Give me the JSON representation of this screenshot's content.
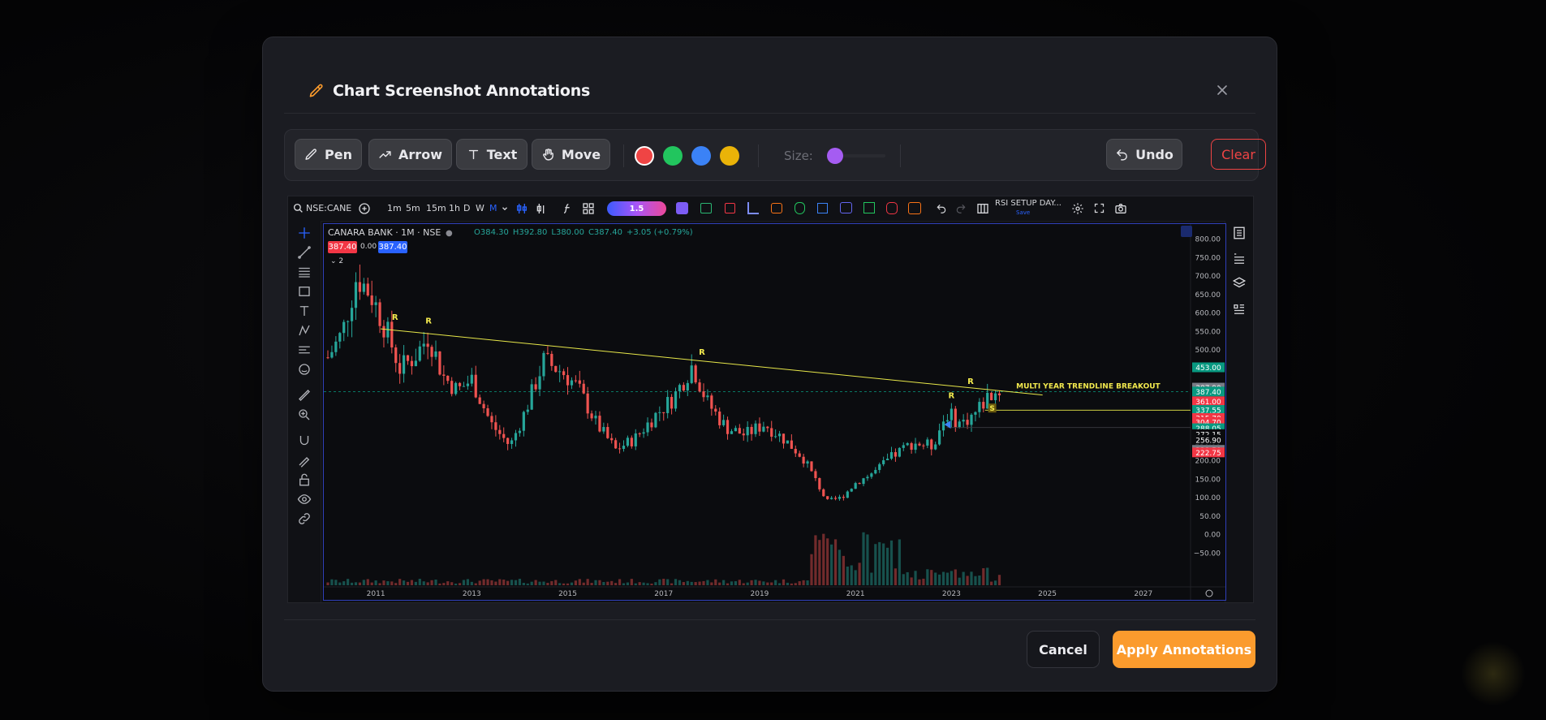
{
  "modal": {
    "title": "Chart Screenshot Annotations",
    "close_icon": "close-icon",
    "accent_color": "#fb9b2d"
  },
  "toolbar": {
    "tools": [
      {
        "label": "Pen",
        "icon": "pen-icon"
      },
      {
        "label": "Arrow",
        "icon": "arrow-icon"
      },
      {
        "label": "Text",
        "icon": "text-icon"
      },
      {
        "label": "Move",
        "icon": "hand-icon"
      }
    ],
    "colors": [
      "#ef4444",
      "#22c55e",
      "#3b82f6",
      "#eab308"
    ],
    "selected_color": "#ef4444",
    "size_label": "Size:",
    "size_color": "#a55cf2",
    "undo_label": "Undo",
    "clear_label": "Clear"
  },
  "tv": {
    "symbol": "NSE:CANE",
    "intervals": [
      "1m",
      "5m",
      "15m",
      "1h",
      "D",
      "W",
      "M"
    ],
    "active_interval": "M",
    "multiplier": "1.5",
    "layout_name": "RSI SETUP DAY...",
    "layout_save": "Save",
    "legend_title": "CANARA BANK · 1M · NSE",
    "ohlc": {
      "o": "O384.30",
      "h": "H392.80",
      "l": "L380.00",
      "c": "C387.40",
      "chg": "+3.05 (+0.79%)"
    },
    "price_box_sell": "387.40",
    "price_box_spread": "0.00",
    "price_box_buy": "387.40",
    "indicator_count": "2"
  },
  "chart_data": {
    "type": "candlestick",
    "symbol": "CANARA BANK",
    "interval": "1M",
    "x_ticks": [
      "2011",
      "2013",
      "2015",
      "2017",
      "2019",
      "2021",
      "2023",
      "2025",
      "2027"
    ],
    "y_ticks": [
      "800.00",
      "750.00",
      "700.00",
      "650.00",
      "600.00",
      "550.00",
      "500.00",
      "450.00",
      "400.00",
      "350.00",
      "300.00",
      "250.00",
      "200.00",
      "150.00",
      "100.00",
      "50.00",
      "0.00",
      "−50.00"
    ],
    "ylim": [
      -60,
      810
    ],
    "price_labels": [
      {
        "value": 453.0,
        "text": "453.00",
        "bg": "#089981"
      },
      {
        "value": 397.9,
        "text": "387.90",
        "bg": "#787b86"
      },
      {
        "value": 387.4,
        "text": "387.40",
        "bg": "#089981"
      },
      {
        "value": 361.0,
        "text": "361.00",
        "bg": "#f23645"
      },
      {
        "value": 337.55,
        "text": "337.55",
        "bg": "#089981"
      },
      {
        "value": 315.7,
        "text": "315.70",
        "bg": "#f23645"
      },
      {
        "value": 304.7,
        "text": "304.70",
        "bg": "#f23645"
      },
      {
        "value": 288.05,
        "text": "288.05",
        "bg": "#089981"
      },
      {
        "value": 272.15,
        "text": "272.15",
        "bg": "#0b0c0f"
      },
      {
        "value": 256.9,
        "text": "256.90",
        "bg": "#0b0c0f"
      },
      {
        "value": 229.5,
        "text": "229.50",
        "bg": "#787b86"
      },
      {
        "value": 222.75,
        "text": "222.75",
        "bg": "#f23645"
      }
    ],
    "annotations": {
      "r_labels": [
        {
          "text": "R",
          "year": 2011.4,
          "value": 582
        },
        {
          "text": "R",
          "year": 2012.1,
          "value": 572
        },
        {
          "text": "R",
          "year": 2017.8,
          "value": 487
        },
        {
          "text": "R",
          "year": 2023.4,
          "value": 408
        },
        {
          "text": "R",
          "year": 2023.0,
          "value": 370
        }
      ],
      "s_label": {
        "text": "S",
        "year": 2023.85,
        "value": 335
      },
      "breakout_text": "MULTI YEAR TRENDLINE BREAKOUT",
      "trendline": {
        "from": [
          2011.1,
          557
        ],
        "to": [
          2024.9,
          378
        ]
      }
    },
    "path": [
      [
        2010.0,
        480
      ],
      [
        2010.3,
        545
      ],
      [
        2010.6,
        700
      ],
      [
        2010.9,
        650
      ],
      [
        2011.2,
        560
      ],
      [
        2011.5,
        450
      ],
      [
        2011.8,
        480
      ],
      [
        2012.1,
        540
      ],
      [
        2012.4,
        430
      ],
      [
        2012.7,
        390
      ],
      [
        2013.0,
        420
      ],
      [
        2013.4,
        300
      ],
      [
        2013.8,
        240
      ],
      [
        2014.1,
        330
      ],
      [
        2014.5,
        470
      ],
      [
        2014.9,
        440
      ],
      [
        2015.2,
        400
      ],
      [
        2015.6,
        300
      ],
      [
        2016.0,
        230
      ],
      [
        2016.4,
        260
      ],
      [
        2016.8,
        320
      ],
      [
        2017.2,
        370
      ],
      [
        2017.6,
        460
      ],
      [
        2017.9,
        360
      ],
      [
        2018.3,
        290
      ],
      [
        2018.7,
        270
      ],
      [
        2019.1,
        300
      ],
      [
        2019.5,
        260
      ],
      [
        2019.9,
        210
      ],
      [
        2020.2,
        140
      ],
      [
        2020.4,
        90
      ],
      [
        2020.7,
        100
      ],
      [
        2021.0,
        140
      ],
      [
        2021.4,
        170
      ],
      [
        2021.8,
        215
      ],
      [
        2022.2,
        250
      ],
      [
        2022.6,
        240
      ],
      [
        2022.9,
        330
      ],
      [
        2023.2,
        300
      ],
      [
        2023.5,
        330
      ],
      [
        2023.8,
        380
      ],
      [
        2024.0,
        387
      ]
    ]
  }
}
